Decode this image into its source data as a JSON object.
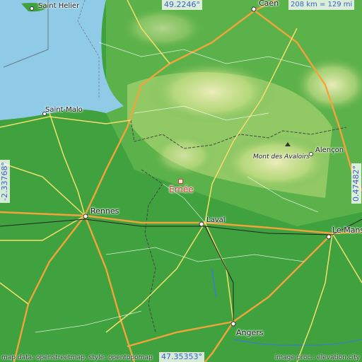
{
  "map": {
    "top_latitude": "49.2246°",
    "bottom_latitude": "47.35353°",
    "left_longitude": "-2.33768°",
    "right_longitude": "0.47482°",
    "scale": "208 km = 129 mi",
    "highlighted_city": "Ernée",
    "attribution_left": "map data: openstreetmap, style: opentopomap",
    "attribution_right": "image proc.: elevation.city"
  },
  "places": {
    "saint_helier": "Saint Helier",
    "caen": "Caen",
    "saint_malo": "Saint-Malo",
    "alencon": "Alençon",
    "mont_des_avaloirs": "Mont des Avaloirs",
    "rennes": "Rennes",
    "laval": "Laval",
    "le_mans": "Le Mans",
    "angers": "Angers"
  },
  "colors": {
    "sea": "#8fcbe6",
    "lowland": "#3fa23f",
    "highland": "#e6e6a6",
    "highway": "#f2a43a",
    "main_road": "#f5df6a",
    "accent": "#d93a3a",
    "coordinate_text": "#3a5fd0"
  }
}
